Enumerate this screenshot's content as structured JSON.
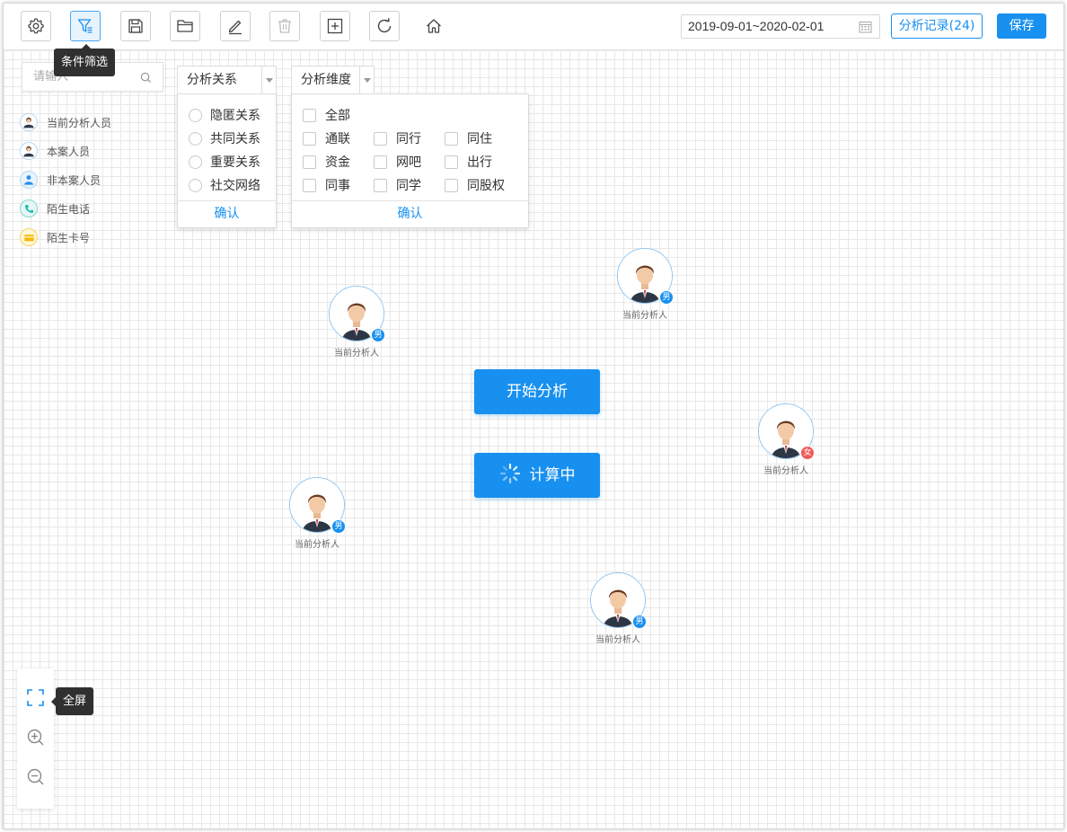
{
  "toolbar": {
    "buttons": [
      {
        "name": "settings-button",
        "icon": "gear-icon"
      },
      {
        "name": "filter-button",
        "icon": "filter-icon",
        "active": true
      },
      {
        "name": "save-file-button",
        "icon": "floppy-icon"
      },
      {
        "name": "open-folder-button",
        "icon": "folder-icon"
      },
      {
        "name": "edit-button",
        "icon": "pencil-icon"
      },
      {
        "name": "delete-button",
        "icon": "trash-icon",
        "disabled": true
      },
      {
        "name": "add-button",
        "icon": "plus-square-icon"
      },
      {
        "name": "refresh-button",
        "icon": "refresh-icon"
      },
      {
        "name": "home-button",
        "icon": "home-icon"
      }
    ],
    "date_range": "2019-09-01~2020-02-01",
    "record_label": "分析记录(24)",
    "save_label": "保存"
  },
  "tooltips": {
    "filter": "条件筛选",
    "fullscreen": "全屏"
  },
  "search": {
    "placeholder": "请输入"
  },
  "legend": {
    "items": [
      {
        "label": "当前分析人员",
        "icon": "person-icon",
        "color": "#2b7fd4"
      },
      {
        "label": "本案人员",
        "icon": "person-icon",
        "color": "#2b7fd4"
      },
      {
        "label": "非本案人员",
        "icon": "person-icon",
        "color": "#2b7fd4"
      },
      {
        "label": "陌生电话",
        "icon": "phone-icon",
        "color": "#2bb8b0"
      },
      {
        "label": "陌生卡号",
        "icon": "card-icon",
        "color": "#f5b800"
      }
    ]
  },
  "relation_filter": {
    "title": "分析关系",
    "options": [
      "隐匿关系",
      "共同关系",
      "重要关系",
      "社交网络"
    ],
    "confirm": "确认"
  },
  "dimension_filter": {
    "title": "分析维度",
    "all": "全部",
    "rows": [
      [
        "通联",
        "同行",
        "同住"
      ],
      [
        "资金",
        "网吧",
        "出行"
      ],
      [
        "同事",
        "同学",
        "同股权"
      ]
    ],
    "confirm": "确认"
  },
  "nodes": [
    {
      "label": "当前分析人",
      "gender": "男",
      "gender_type": "male"
    },
    {
      "label": "当前分析人",
      "gender": "男",
      "gender_type": "male"
    },
    {
      "label": "当前分析人",
      "gender": "女",
      "gender_type": "female"
    },
    {
      "label": "当前分析人",
      "gender": "男",
      "gender_type": "male"
    },
    {
      "label": "当前分析人",
      "gender": "男",
      "gender_type": "male"
    }
  ],
  "actions": {
    "start": "开始分析",
    "computing": "计算中"
  },
  "colors": {
    "primary": "#1890f0",
    "female": "#ef5b5b"
  }
}
